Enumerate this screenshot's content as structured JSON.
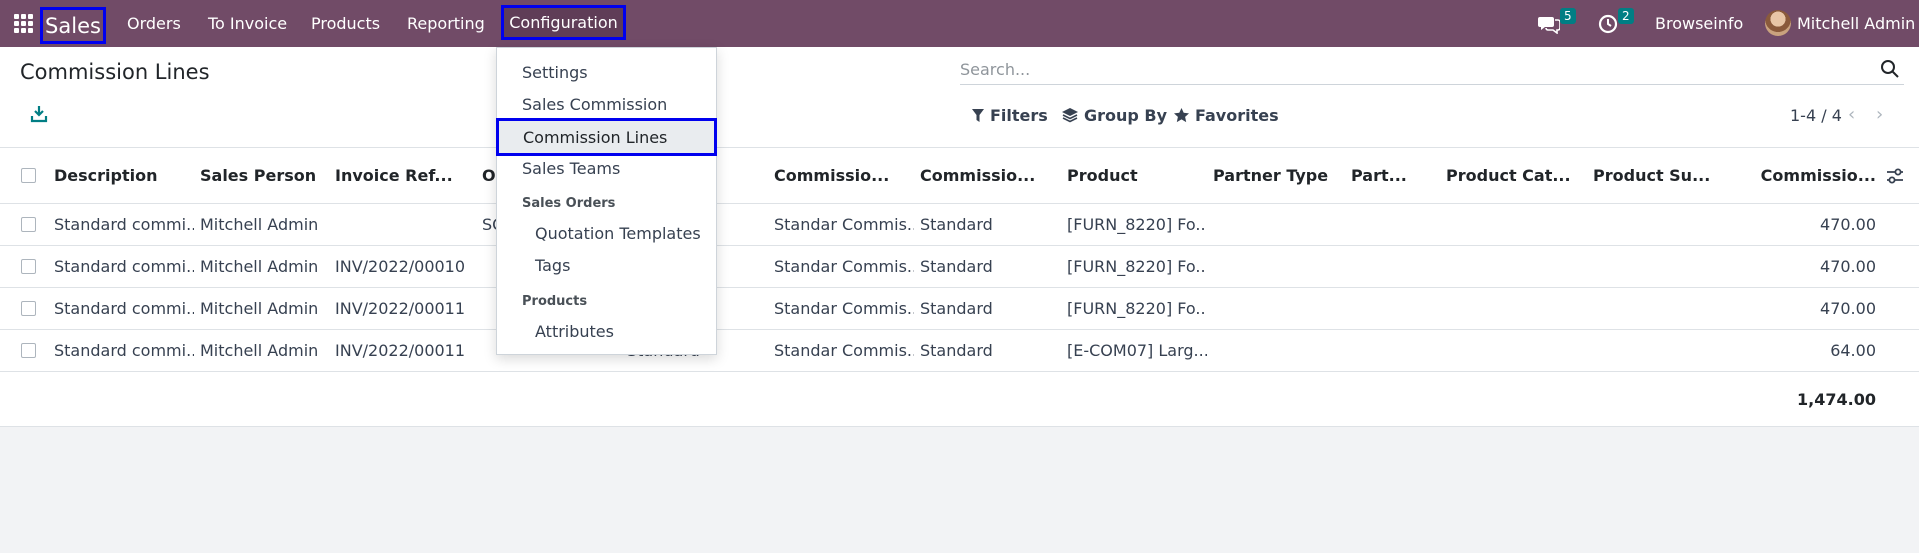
{
  "navbar": {
    "brand": "Sales",
    "menu": [
      "Orders",
      "To Invoice",
      "Products",
      "Reporting",
      "Configuration"
    ],
    "chat_badge": "5",
    "activity_badge": "2",
    "company": "Browseinfo",
    "user": "Mitchell Admin"
  },
  "control": {
    "title": "Commission Lines",
    "search_placeholder": "Search...",
    "filters_label": "Filters",
    "groupby_label": "Group By",
    "favorites_label": "Favorites",
    "pager": "1-4 / 4"
  },
  "table": {
    "headers": [
      "Description",
      "Sales Person",
      "Invoice Ref...",
      "O",
      "...",
      "Commissio...",
      "Commissio...",
      "Product",
      "Partner Type",
      "Part...",
      "Product Cat...",
      "Product Su...",
      "Commissio..."
    ],
    "rows": [
      {
        "description": "Standard commi...",
        "sales_person": "Mitchell Admin",
        "invoice_ref": "",
        "origin": "SO",
        "commission_type": "",
        "commission_name": "Standar Commis...",
        "commission_basis": "Standard",
        "product": "[FURN_8220] Fo...",
        "amount": "470.00"
      },
      {
        "description": "Standard commi...",
        "sales_person": "Mitchell Admin",
        "invoice_ref": "INV/2022/00010",
        "origin": "",
        "commission_type": "",
        "commission_name": "Standar Commis...",
        "commission_basis": "Standard",
        "product": "[FURN_8220] Fo...",
        "amount": "470.00"
      },
      {
        "description": "Standard commi...",
        "sales_person": "Mitchell Admin",
        "invoice_ref": "INV/2022/00011",
        "origin": "",
        "commission_type": "",
        "commission_name": "Standar Commis...",
        "commission_basis": "Standard",
        "product": "[FURN_8220] Fo...",
        "amount": "470.00"
      },
      {
        "description": "Standard commi...",
        "sales_person": "Mitchell Admin",
        "invoice_ref": "INV/2022/00011",
        "origin": "",
        "commission_type": "Standard",
        "commission_name": "Standar Commis...",
        "commission_basis": "Standard",
        "product": "[E-COM07] Larg...",
        "amount": "64.00"
      }
    ],
    "total": "1,474.00"
  },
  "dropdown": {
    "items": [
      "Settings",
      "Sales Commission",
      "Commission Lines",
      "Sales Teams"
    ],
    "sales_orders_header": "Sales Orders",
    "sales_orders_items": [
      "Quotation Templates",
      "Tags"
    ],
    "products_header": "Products",
    "products_items": [
      "Attributes"
    ]
  },
  "colors": {
    "navbar": "#714b67",
    "highlight_border": "#0000ee",
    "badge": "#017e84"
  }
}
